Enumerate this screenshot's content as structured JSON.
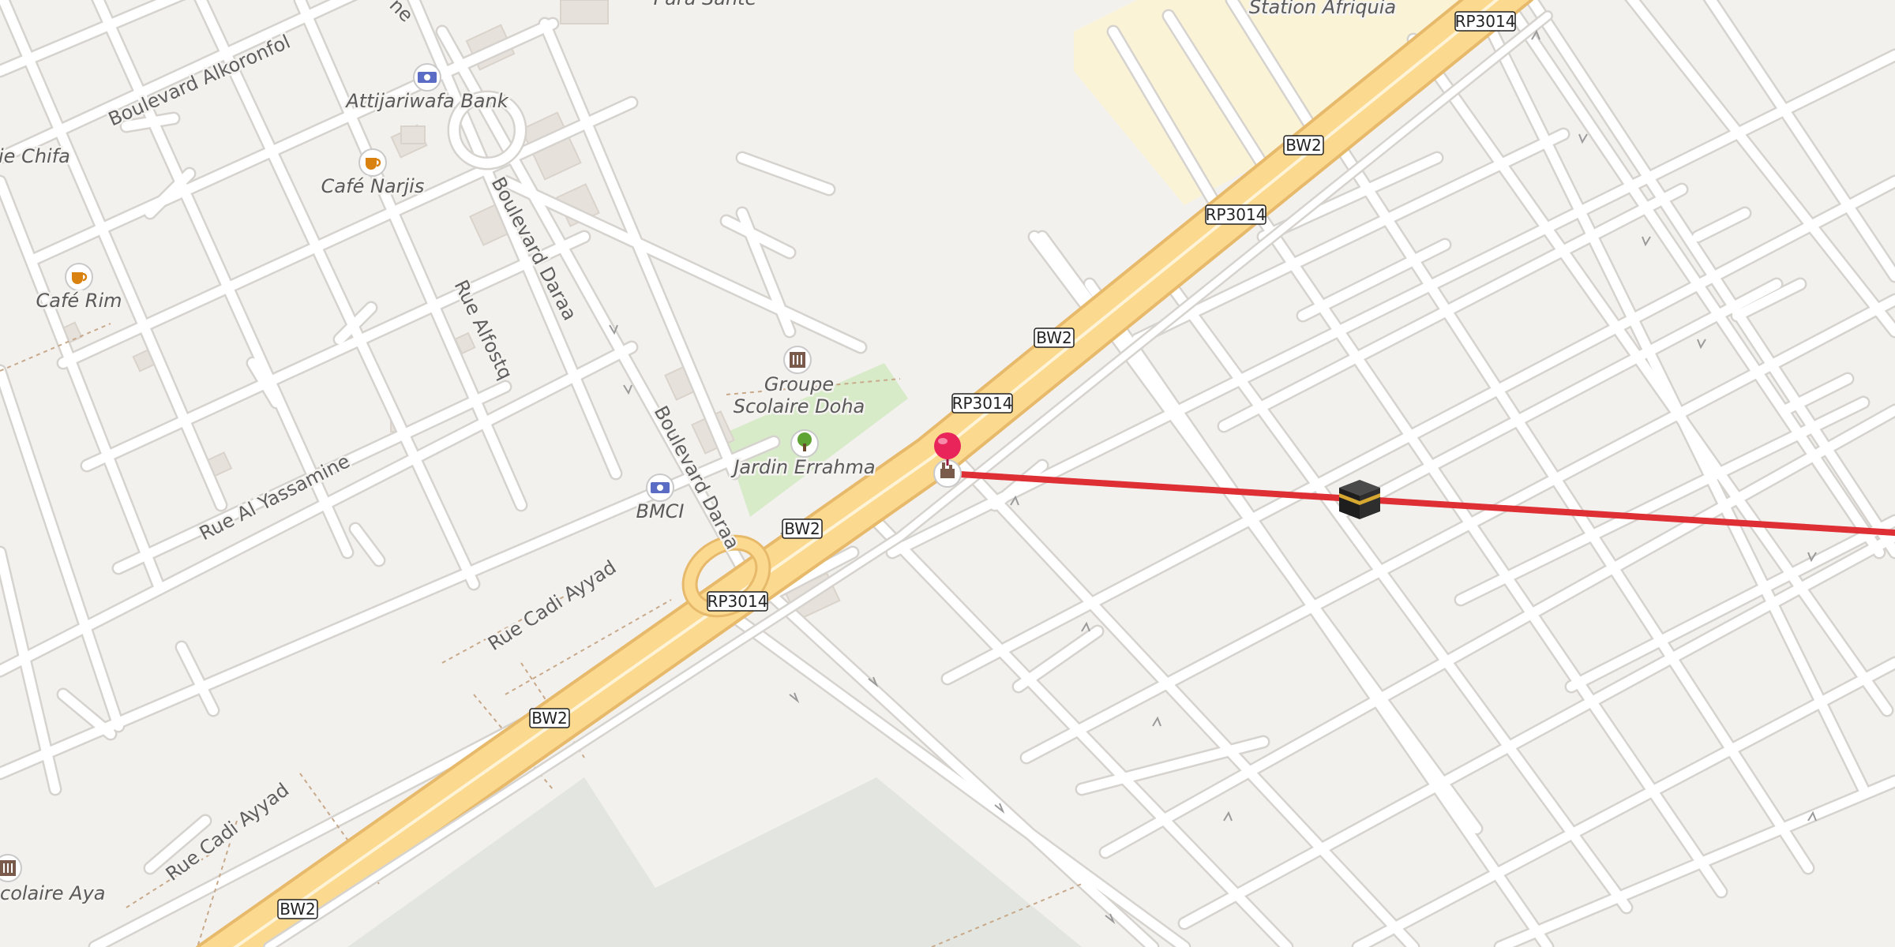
{
  "map": {
    "colors": {
      "background": "#f3f1ee",
      "road_minor": "#ffffff",
      "road_casing": "#d6d3cf",
      "road_major": "#fbd98f",
      "road_major_casing": "#e7b96b",
      "park": "#d8ebc9",
      "farmland": "#fbf3d6",
      "landuse_gray": "#e3e6e0",
      "route_line": "#de2f35",
      "pin": "#e8245b"
    },
    "streets": [
      {
        "id": "boulevard-alkoronfol",
        "name": "Boulevard Alkoronfol"
      },
      {
        "id": "boulevard-daraa-north",
        "name": "Boulevard Daraa"
      },
      {
        "id": "boulevard-daraa-south",
        "name": "Boulevard Daraa"
      },
      {
        "id": "rue-alfostq",
        "name": "Rue Alfostq"
      },
      {
        "id": "rue-al-yassamine",
        "name": "Rue Al Yassamine"
      },
      {
        "id": "rue-cadi-ayyad-north",
        "name": "Rue Cadi Ayyad"
      },
      {
        "id": "rue-cadi-ayyad-south",
        "name": "Rue Cadi Ayyad"
      },
      {
        "id": "street-fragment-ne",
        "name": "ne"
      }
    ],
    "route_shields": [
      {
        "id": "rp3014-a",
        "label": "RP3014"
      },
      {
        "id": "bw2-a",
        "label": "BW2"
      },
      {
        "id": "rp3014-b",
        "label": "RP3014"
      },
      {
        "id": "bw2-b",
        "label": "BW2"
      },
      {
        "id": "rp3014-c",
        "label": "RP3014"
      },
      {
        "id": "bw2-c",
        "label": "BW2"
      },
      {
        "id": "rp3014-d",
        "label": "RP3014"
      },
      {
        "id": "bw2-d",
        "label": "BW2"
      },
      {
        "id": "bw2-e",
        "label": "BW2"
      }
    ],
    "pois": [
      {
        "id": "attijariwafa-bank",
        "name": "Attijariwafa Bank",
        "icon": "bank-icon"
      },
      {
        "id": "cafe-narjis",
        "name": "Café Narjis",
        "icon": "cafe-icon"
      },
      {
        "id": "cafe-rim",
        "name": "Café Rim",
        "icon": "cafe-icon"
      },
      {
        "id": "chifa",
        "name": "ie Chifa",
        "icon": ""
      },
      {
        "id": "groupe-scolaire-doha",
        "name_line1": "Groupe",
        "name_line2": "Scolaire Doha",
        "icon": "school-icon"
      },
      {
        "id": "jardin-errahma",
        "name": "Jardin Errahma",
        "icon": "park-tree-icon"
      },
      {
        "id": "bmci",
        "name": "BMCI",
        "icon": "bank-icon"
      },
      {
        "id": "scolaire-aya",
        "name": "colaire Aya",
        "icon": "school-icon"
      },
      {
        "id": "para-sante",
        "name": "Para Santé",
        "icon": ""
      },
      {
        "id": "station-afriquia",
        "name": "Station Afriquia",
        "icon": ""
      }
    ],
    "markers": [
      {
        "id": "location-pin",
        "icon": "map-pin-icon"
      },
      {
        "id": "origin-marker",
        "icon": "factory-icon"
      },
      {
        "id": "qibla-kaaba",
        "icon": "kaaba-icon"
      }
    ],
    "route_line": {
      "id": "qibla-direction-line",
      "color": "#de2f35"
    }
  }
}
